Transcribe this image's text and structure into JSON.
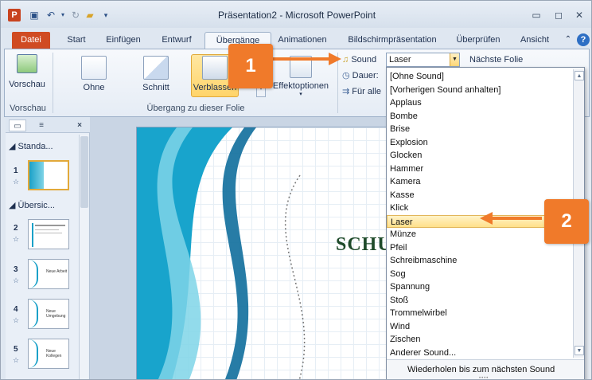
{
  "window": {
    "title": "Präsentation2 - Microsoft PowerPoint",
    "controls": [
      "▭",
      "◻",
      "✕"
    ]
  },
  "tabs": [
    "Datei",
    "Start",
    "Einfügen",
    "Entwurf",
    "Übergänge",
    "Animationen",
    "Bildschirmpräsentation",
    "Überprüfen",
    "Ansicht"
  ],
  "ribbon": {
    "preview": {
      "button": "Vorschau",
      "group": "Vorschau"
    },
    "transitions": {
      "items": [
        "Ohne",
        "Schnitt",
        "Verblassen"
      ],
      "effect_options": "Effektoptionen",
      "group": "Übergang zu dieser Folie"
    },
    "timing": {
      "sound_label": "Sound",
      "sound_value": "Laser",
      "next_slide": "Nächste Folie",
      "duration_label": "Dauer:",
      "apply_all": "Für alle"
    }
  },
  "panel": {
    "sections": [
      "Standa...",
      "Übersic..."
    ],
    "slides": [
      {
        "num": "1",
        "text": ""
      },
      {
        "num": "2",
        "text": ""
      },
      {
        "num": "3",
        "text": "Neue Arbeit"
      },
      {
        "num": "4",
        "text": "Neue Umgebung"
      },
      {
        "num": "5",
        "text": "Neue Kollegen"
      }
    ]
  },
  "slide": {
    "title": "SCHUL"
  },
  "sound_dropdown": {
    "items": [
      "[Ohne Sound]",
      "[Vorherigen Sound anhalten]",
      "Applaus",
      "Bombe",
      "Brise",
      "Explosion",
      "Glocken",
      "Hammer",
      "Kamera",
      "Kasse",
      "Klick",
      "Laser",
      "Münze",
      "Pfeil",
      "Schreibmaschine",
      "Sog",
      "Spannung",
      "Stoß",
      "Trommelwirbel",
      "Wind",
      "Zischen",
      "Anderer Sound..."
    ],
    "selected_index": 11,
    "footer": "Wiederholen bis zum nächsten Sound"
  },
  "callouts": {
    "first": "1",
    "second": "2"
  },
  "colors": {
    "accent_orange": "#f07a2a",
    "file_tab": "#d04b22",
    "selection": "#ffe08a"
  }
}
